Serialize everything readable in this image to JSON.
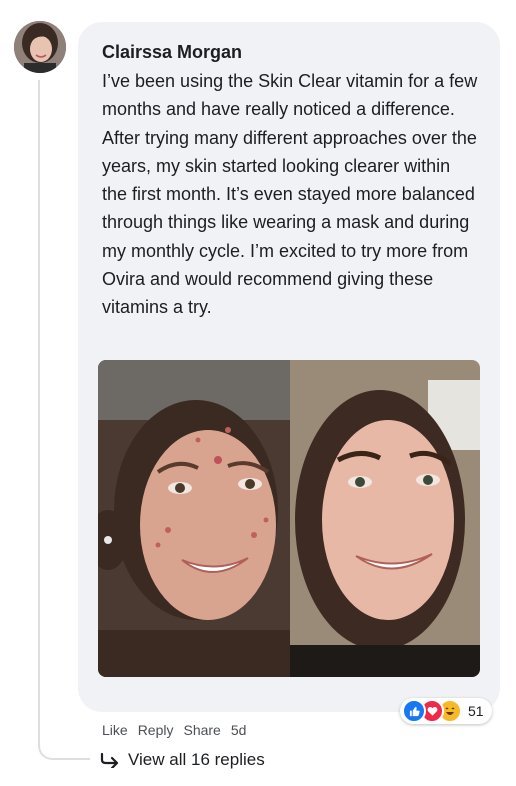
{
  "comment": {
    "author": "Clairssa Morgan",
    "text": "I’ve been using the Skin Clear vitamin for a few months and have really noticed a difference. After trying many different approaches over the years, my skin started looking clearer within the first month. It’s even stayed more balanced through things like wearing a mask and during my monthly cycle. I’m excited to try more from Ovira and would recommend giving these vitamins a try.",
    "photo": {
      "left": "before",
      "right": "after"
    }
  },
  "reactions": {
    "icons": [
      "like-icon",
      "love-icon",
      "haha-icon"
    ],
    "count": "51"
  },
  "actions": {
    "like": "Like",
    "reply": "Reply",
    "share": "Share",
    "time": "5d"
  },
  "replies": {
    "label": "View all 16 replies",
    "icon": "reply-arrow-icon"
  },
  "colors": {
    "bubble": "#f0f2f5",
    "like": "#1877f2",
    "love": "#f02849",
    "haha": "#f7b928"
  }
}
